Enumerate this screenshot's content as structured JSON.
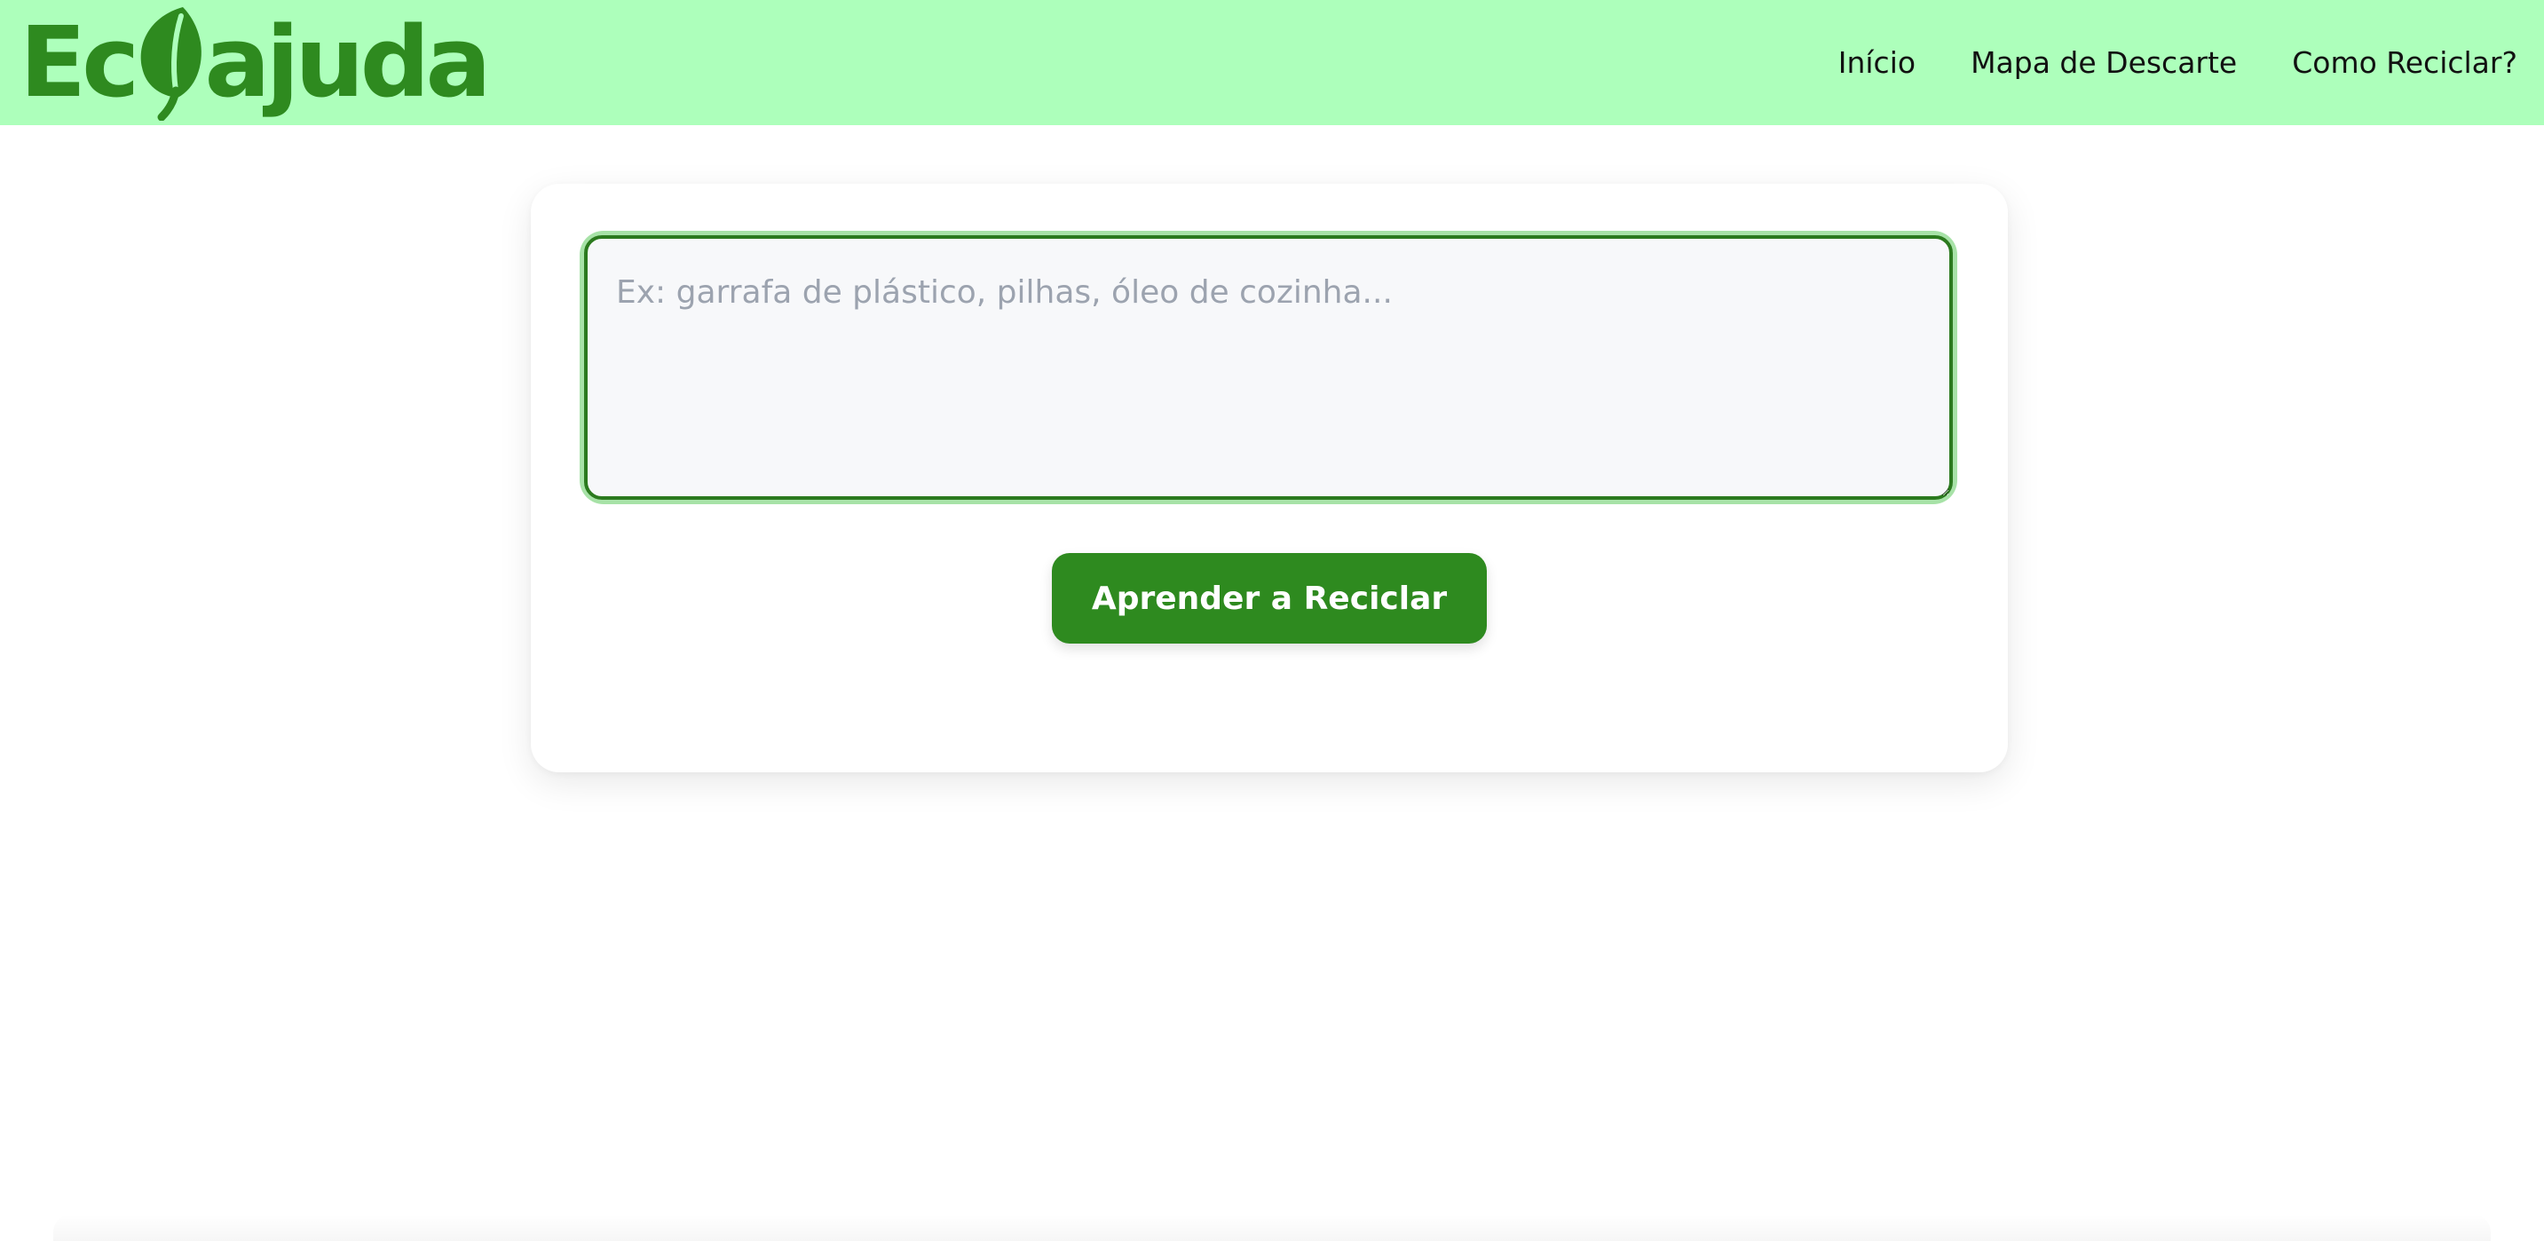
{
  "header": {
    "logo": {
      "prefix": "Ec",
      "suffix": "ajuda",
      "leaf_icon": "leaf-icon",
      "brand_color": "#2e8a1f"
    },
    "nav": [
      {
        "label": "Início"
      },
      {
        "label": "Mapa de Descarte"
      },
      {
        "label": "Como Reciclar?"
      }
    ],
    "background_color": "#adffbb"
  },
  "main": {
    "search": {
      "placeholder": "Ex: garrafa de plástico, pilhas, óleo de cozinha...",
      "value": ""
    },
    "submit_label": "Aprender a Reciclar"
  }
}
